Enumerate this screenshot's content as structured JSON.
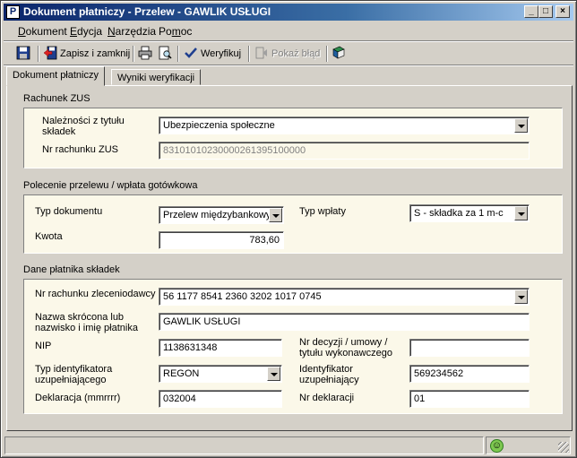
{
  "window": {
    "title": "Dokument płatniczy - Przelew - GAWLIK USŁUGI",
    "app_icon": "P",
    "controls": {
      "minimize": "_",
      "maximize": "□",
      "close": "×"
    }
  },
  "menu": [
    {
      "accel": "D",
      "rest": "okument"
    },
    {
      "accel": "E",
      "rest": "dycja"
    },
    {
      "accel": "N",
      "rest": "arzędzia"
    },
    {
      "pre": "Po",
      "accel": "m",
      "rest": "oc"
    }
  ],
  "toolbar": {
    "save_close": "Zapisz i zamknij",
    "verify": "Weryfikuj",
    "show_error": "Pokaż błąd"
  },
  "tabs": {
    "active": "Dokument płatniczy",
    "inactive": "Wyniki weryfikacji"
  },
  "sections": {
    "zus": {
      "title": "Rachunek ZUS",
      "receivables_label": "Należności z tytułu składek",
      "receivables_value": "Ubezpieczenia społeczne",
      "account_label": "Nr rachunku ZUS",
      "account_value": "83101010230000261395100000"
    },
    "transfer": {
      "title": "Polecenie przelewu / wpłata gotówkowa",
      "doc_type_label": "Typ dokumentu",
      "doc_type_value": "Przelew międzybankowy",
      "payment_type_label": "Typ wpłaty",
      "payment_type_value": "S - składka za 1 m-c",
      "amount_label": "Kwota",
      "amount_value": "783,60"
    },
    "payer": {
      "title": "Dane płatnika składek",
      "payer_account_label": "Nr rachunku zleceniodawcy",
      "payer_account_value": "56 1177 8541 2360 3202 1017 0745",
      "short_name_label": "Nazwa skrócona lub nazwisko i imię płatnika",
      "short_name_value": "GAWLIK USŁUGI",
      "nip_label": "NIP",
      "nip_value": "1138631348",
      "decision_label": "Nr decyzji / umowy / tytułu wykonawczego",
      "decision_value": "",
      "id_type_label": "Typ identyfikatora uzupełniającego",
      "id_type_value": "REGON",
      "id_label": "Identyfikator uzupełniający",
      "id_value": "569234562",
      "declaration_label": "Deklaracja (mmrrrr)",
      "declaration_value": "032004",
      "declaration_no_label": "Nr deklaracji",
      "declaration_no_value": "01"
    }
  },
  "status": {
    "icon": "smiley-icon"
  }
}
